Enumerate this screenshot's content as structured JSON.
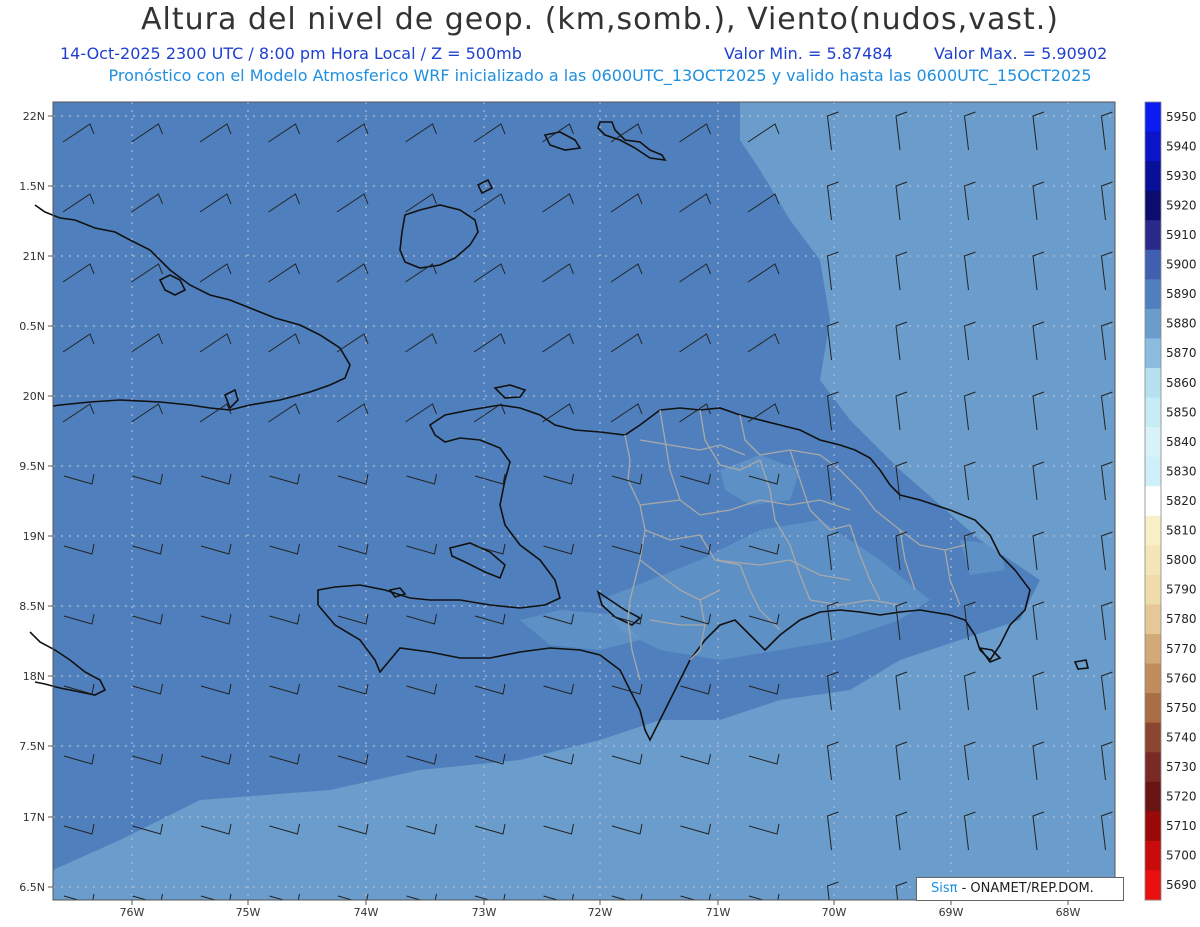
{
  "header": {
    "title": "Altura del nivel de geop. (km,somb.), Viento(nudos,vast.)",
    "date_time": "14-Oct-2025  2300 UTC / 8:00 pm Hora Local / Z = 500mb",
    "valor_min": "Valor Min. = 5.87484",
    "valor_max": "Valor Max. = 5.90902",
    "subtitle": "Pronóstico con el Modelo Atmosferico WRF inicializado a las 0600UTC_13OCT2025 y valido hasta las  0600UTC_15OCT2025"
  },
  "map": {
    "lat_labels": [
      "22N",
      "1.5N",
      "21N",
      "0.5N",
      "20N",
      "9.5N",
      "19N",
      "8.5N",
      "18N",
      "7.5N",
      "17N",
      "6.5N"
    ],
    "lon_labels": [
      "76W",
      "75W",
      "74W",
      "73W",
      "72W",
      "71W",
      "70W",
      "69W",
      "68W"
    ],
    "colors": {
      "field_main": "#4f80bd",
      "field_east": "#6a9dcc",
      "coast": "#111111",
      "borders": "#a8a8a8",
      "grid": "#b0bcd0"
    }
  },
  "colorbar": {
    "levels": [
      "5950",
      "5940",
      "5930",
      "5920",
      "5910",
      "5900",
      "5890",
      "5880",
      "5870",
      "5860",
      "5850",
      "5840",
      "5830",
      "5820",
      "5810",
      "5800",
      "5790",
      "5780",
      "5770",
      "5760",
      "5750",
      "5740",
      "5730",
      "5720",
      "5710",
      "5700",
      "5690"
    ],
    "colors": [
      "#0a1cf0",
      "#0a14c8",
      "#08109a",
      "#0a0c6e",
      "#2a2a8c",
      "#3f5fb0",
      "#4f80bd",
      "#6a9dcc",
      "#8cbde0",
      "#b6e2f0",
      "#c8ecf4",
      "#d8f2f8",
      "#cff0f8",
      "#ffffff",
      "#f8f0c8",
      "#f4e6b8",
      "#f0dcaa",
      "#e6c898",
      "#d2aa78",
      "#c08c5c",
      "#aa6e46",
      "#8c4630",
      "#7a2a24",
      "#6a1414",
      "#9a0a0a",
      "#c80c0c",
      "#e81010"
    ]
  },
  "credit": {
    "brand": "Sisπ",
    "org": " - ONAMET/REP.DOM."
  }
}
